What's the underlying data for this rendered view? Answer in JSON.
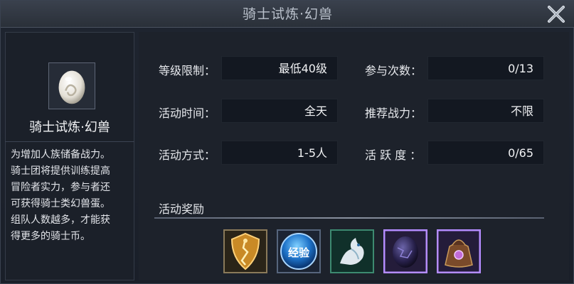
{
  "window": {
    "title": "骑士试炼·幻兽"
  },
  "left": {
    "name": "骑士试炼·幻兽",
    "description": [
      "为增加人族储备战力。",
      "骑士团将提供训练提高",
      "冒险者实力，参与者还",
      "可获得骑士类幻兽蛋。",
      "组队人数越多，才能获",
      "得更多的骑士币。"
    ]
  },
  "info": {
    "level_label": "等级限制：",
    "level_value": "最低40级",
    "count_label": "参与次数：",
    "count_value": "0/13",
    "time_label": "活动时间：",
    "time_value": "全天",
    "power_label": "推荐战力：",
    "power_value": "不限",
    "mode_label": "活动方式：",
    "mode_value": "1-5人",
    "active_label": "活 跃 度 ：",
    "active_value": "0/65"
  },
  "rewards": {
    "title": "活动奖励",
    "items": [
      {
        "icon": "golden-shield-icon",
        "text": ""
      },
      {
        "icon": "exp-orb-icon",
        "text": "经验"
      },
      {
        "icon": "white-dragon-icon",
        "text": ""
      },
      {
        "icon": "dark-egg-icon",
        "text": ""
      },
      {
        "icon": "treasure-bag-icon",
        "text": ""
      }
    ]
  }
}
